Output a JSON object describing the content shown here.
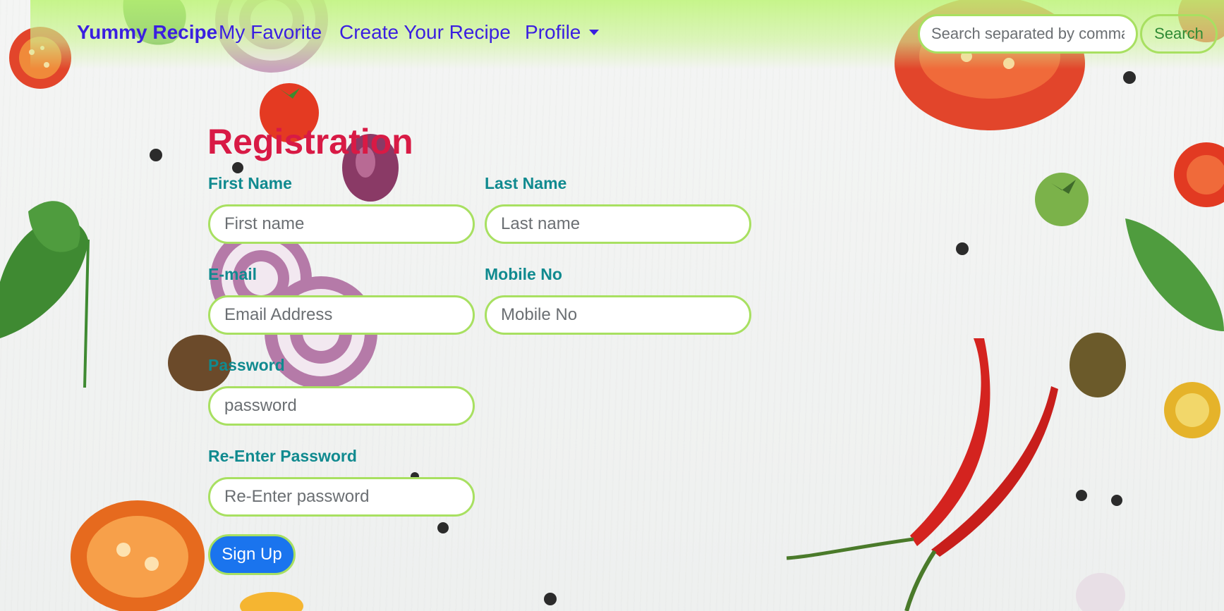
{
  "navbar": {
    "brand": "Yummy Recipe",
    "links": [
      "My Favorite",
      "Create Your Recipe",
      "Profile"
    ],
    "search_placeholder": "Search separated by comma",
    "search_button": "Search"
  },
  "form": {
    "title": "Registration",
    "first_name": {
      "label": "First Name",
      "placeholder": "First name"
    },
    "last_name": {
      "label": "Last Name",
      "placeholder": "Last name"
    },
    "email": {
      "label": "E-mail",
      "placeholder": "Email Address"
    },
    "mobile": {
      "label": "Mobile No",
      "placeholder": "Mobile No"
    },
    "password": {
      "label": "Password",
      "placeholder": "password"
    },
    "reenter_password": {
      "label": "Re-Enter Password",
      "placeholder": "Re-Enter password"
    },
    "submit": "Sign Up"
  },
  "colors": {
    "brand": "#3a1fe0",
    "title": "#d81a45",
    "label": "#108a8f",
    "field_border": "#a8e061",
    "button": "#1a74ee"
  },
  "icons": [
    "dropdown-caret-icon"
  ]
}
